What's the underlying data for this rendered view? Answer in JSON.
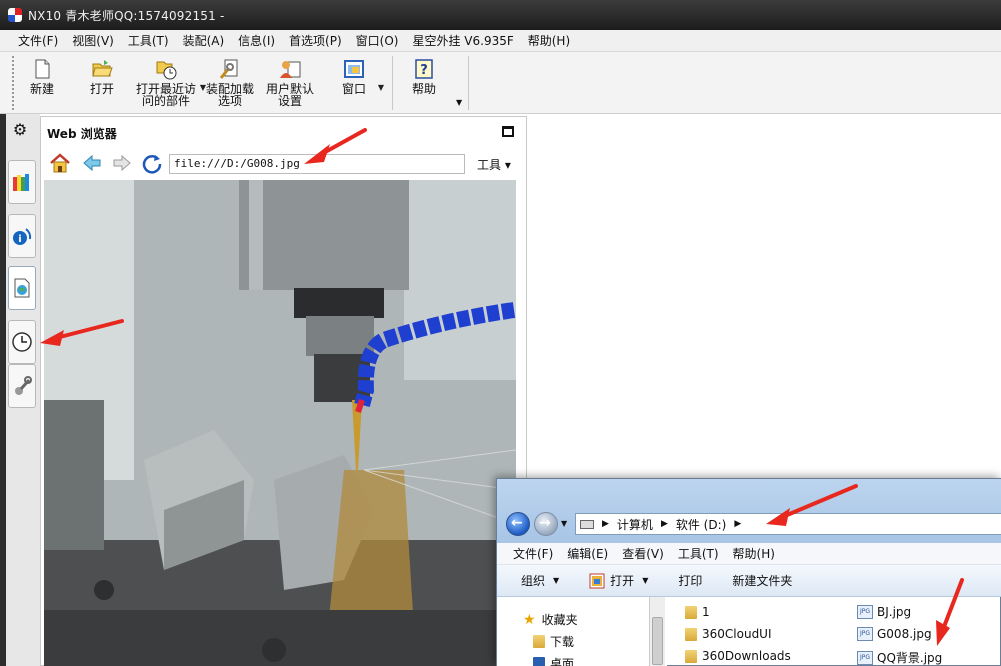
{
  "window": {
    "title": "NX10 青木老师QQ:1574092151 -"
  },
  "menubar": {
    "items": [
      "文件(F)",
      "视图(V)",
      "工具(T)",
      "装配(A)",
      "信息(I)",
      "首选项(P)",
      "窗口(O)",
      "星空外挂 V6.935F",
      "帮助(H)"
    ]
  },
  "ribbon": {
    "new_label": "新建",
    "open_label": "打开",
    "recent_label": "打开最近访\n问的部件",
    "assembly_label": "装配加载\n选项",
    "defaults_label": "用户默认\n设置",
    "window_label": "窗口",
    "help_label": "帮助"
  },
  "webpanel": {
    "title": "Web 浏览器",
    "url": "file:///D:/G008.jpg",
    "tools_label": "工具 ▾"
  },
  "explorer": {
    "breadcrumbs": [
      "计算机",
      "软件 (D:)"
    ],
    "menu": [
      "文件(F)",
      "编辑(E)",
      "查看(V)",
      "工具(T)",
      "帮助(H)"
    ],
    "commands": {
      "organize": "组织",
      "open": "打开",
      "print": "打印",
      "new_folder": "新建文件夹"
    },
    "nav": {
      "favorites": "收藏夹",
      "downloads": "下载",
      "desktop": "桌面"
    },
    "folders": [
      "1",
      "360CloudUI",
      "360Downloads"
    ],
    "files": [
      "BJ.jpg",
      "G008.jpg",
      "QQ背景.jpg"
    ],
    "jpg_badge": "JPG"
  },
  "colors": {
    "annotation_arrow": "#e8281e",
    "titlebar": "#2a2a2a",
    "explorer_header": "#b4cde9"
  }
}
